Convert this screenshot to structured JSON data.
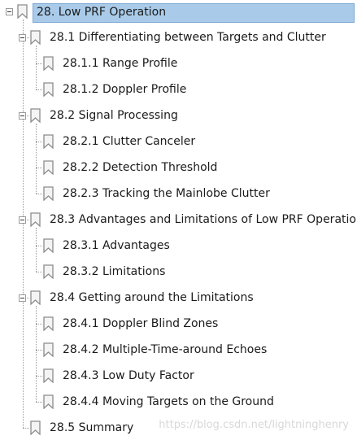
{
  "root": {
    "label": "28. Low PRF Operation",
    "expanded": true,
    "selected": true
  },
  "sections": [
    {
      "label": "28.1 Differentiating between Targets and Clutter",
      "expanded": true,
      "children": [
        "28.1.1 Range Profile",
        "28.1.2 Doppler Profile"
      ]
    },
    {
      "label": "28.2 Signal Processing",
      "expanded": true,
      "children": [
        "28.2.1 Clutter Canceler",
        "28.2.2 Detection Threshold",
        "28.2.3 Tracking the Mainlobe Clutter"
      ]
    },
    {
      "label": "28.3 Advantages and Limitations of Low PRF Operation",
      "expanded": true,
      "children": [
        "28.3.1 Advantages",
        "28.3.2 Limitations"
      ]
    },
    {
      "label": "28.4 Getting around the Limitations",
      "expanded": true,
      "children": [
        "28.4.1 Doppler Blind Zones",
        "28.4.2 Multiple-Time-around Echoes",
        "28.4.3 Low Duty Factor",
        "28.4.4 Moving Targets on the Ground"
      ]
    },
    {
      "label": "28.5 Summary",
      "expanded": false,
      "children": []
    }
  ],
  "watermark": "https://blog.csdn.net/lightninghenry",
  "colors": {
    "selection": "#a9cbe9",
    "connector": "#9a9a9a",
    "icon": "#8c8c8c"
  },
  "icons": {
    "toggle": "collapse-minus-icon",
    "bookmark": "bookmark-icon"
  }
}
